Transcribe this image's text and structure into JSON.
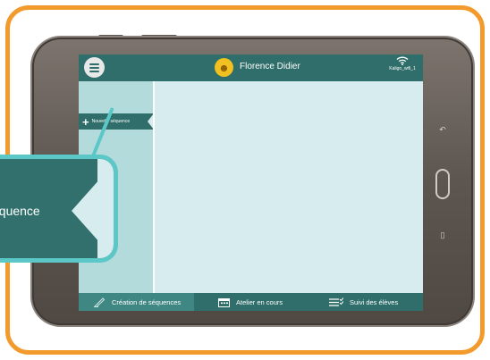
{
  "topbar": {
    "menu_icon": "hamburger-menu-icon",
    "user_name": "Florence Didier",
    "avatar_icon": "chick-avatar-icon",
    "wifi_icon": "wifi-icon",
    "wifi_name": "Kaligo_wifi_1"
  },
  "sidebar": {
    "new_sequence_label": "Nouvelle séquence",
    "new_sequence_icon": "plus-icon"
  },
  "bottombar": {
    "tabs": [
      {
        "label": "Création de séquences",
        "icon": "pen-icon",
        "active": true
      },
      {
        "label": "Atelier en cours",
        "icon": "calendar-icon",
        "active": false
      },
      {
        "label": "Suivi des élèves",
        "icon": "checklist-icon",
        "active": false
      }
    ]
  },
  "callout": {
    "zoom_text": "équence"
  },
  "colors": {
    "frame_border": "#f39a2c",
    "app_primary": "#2f6e6a",
    "sidebar_bg": "#b3dbdc",
    "content_bg": "#d6ecef",
    "callout_border": "#5bc7c6"
  }
}
